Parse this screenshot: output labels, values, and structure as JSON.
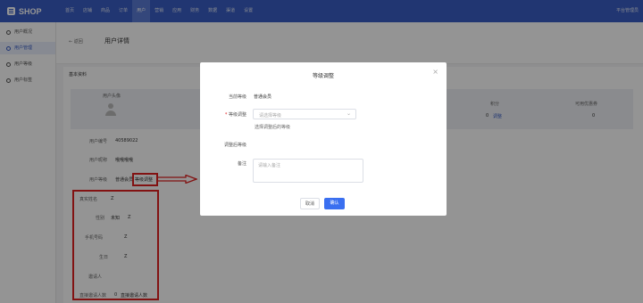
{
  "topbar": {
    "logo": "SHOP",
    "nav": [
      "首页",
      "店铺",
      "商品",
      "订单",
      "用户",
      "营销",
      "应用",
      "财务",
      "数据",
      "渠道",
      "设置"
    ],
    "active_nav": "用户",
    "platform": "平台管理员",
    "bg_color": "#3a5ec4"
  },
  "sidebar": {
    "items": [
      {
        "label": "用户概况",
        "icon": "user-icon"
      },
      {
        "label": "用户管理",
        "icon": "user-icon"
      },
      {
        "label": "用户等级",
        "icon": "crown-icon"
      },
      {
        "label": "用户标签",
        "icon": "tag-icon"
      }
    ],
    "active": "用户管理"
  },
  "page": {
    "back_label": "← 返回",
    "title": "用户详情",
    "section_title": "基本资料"
  },
  "stats": {
    "avatar_label": "用户头像",
    "points_label": "积分",
    "points_value": "0",
    "points_link": "调整",
    "coupon_label": "可用优惠券",
    "coupon_value": "0"
  },
  "profile": {
    "id_label": "用户编号",
    "id_value": "40589022",
    "nick_label": "用户昵称",
    "nick_value": "哦哦哦哦",
    "level_label": "用户等级",
    "level_value": "普通会员",
    "level_link": "等级调整",
    "name_label": "真实姓名",
    "name_value": "Z",
    "gender_label": "性别",
    "gender_value": "未知",
    "gender_extra": "Z",
    "phone_label": "手机号码",
    "phone_value": "Z",
    "birthday_label": "生日",
    "birthday_value": "Z",
    "inviter_label": "邀请人",
    "invites_label": "直接邀请人数",
    "invites_value": "0",
    "invites_link": "直接邀请人数"
  },
  "modal": {
    "title": "等级调整",
    "current_label": "当前等级",
    "current_value": "普通会员",
    "adjust_label": "等级调整",
    "adjust_placeholder": "请选择等级",
    "adjust_hint": "选择调整后的等级",
    "after_label": "调整后等级",
    "remark_label": "备注",
    "remark_placeholder": "请输入备注",
    "cancel": "取消",
    "confirm": "确认"
  },
  "annotation_color": "#e02020"
}
